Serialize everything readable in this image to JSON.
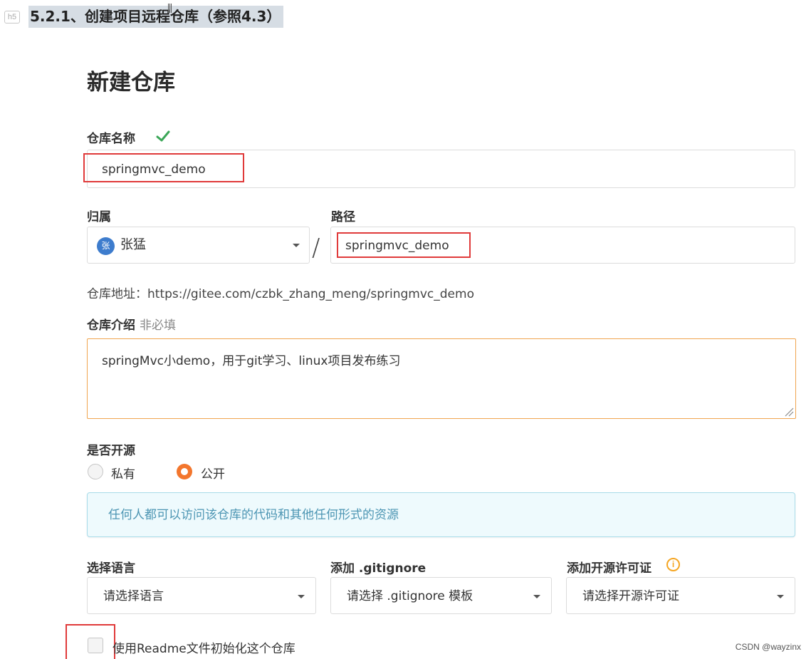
{
  "doc_heading": {
    "tag": "h5",
    "text": "5.2.1、创建项目远程仓库（参照4.3）"
  },
  "form": {
    "title": "新建仓库",
    "repo_name": {
      "label": "仓库名称",
      "value": "springmvc_demo"
    },
    "owner": {
      "label": "归属",
      "avatar_char": "张",
      "value": "张猛"
    },
    "path": {
      "label": "路径",
      "separator": "/",
      "value": "springmvc_demo"
    },
    "repo_url": "仓库地址：https://gitee.com/czbk_zhang_meng/springmvc_demo",
    "description": {
      "label": "仓库介绍",
      "optional": "非必填",
      "value": "springMvc小demo，用于git学习、linux项目发布练习"
    },
    "open_source": {
      "label": "是否开源",
      "options": [
        "私有",
        "公开"
      ],
      "selected": "公开",
      "info": "任何人都可以访问该仓库的代码和其他任何形式的资源"
    },
    "language": {
      "label": "选择语言",
      "value": "请选择语言"
    },
    "gitignore": {
      "label": "添加 .gitignore",
      "value": "请选择 .gitignore 模板"
    },
    "license": {
      "label": "添加开源许可证",
      "value": "请选择开源许可证",
      "info_icon": "i"
    },
    "readme": {
      "label": "使用Readme文件初始化这个仓库",
      "checked": false
    }
  },
  "watermark": "CSDN @wayzinx",
  "colors": {
    "accent_orange": "#f3762d",
    "success_green": "#3aa657",
    "annotation_red": "#e03a3a",
    "info_text": "#4c95b3",
    "avatar_blue": "#3d7ccd"
  }
}
